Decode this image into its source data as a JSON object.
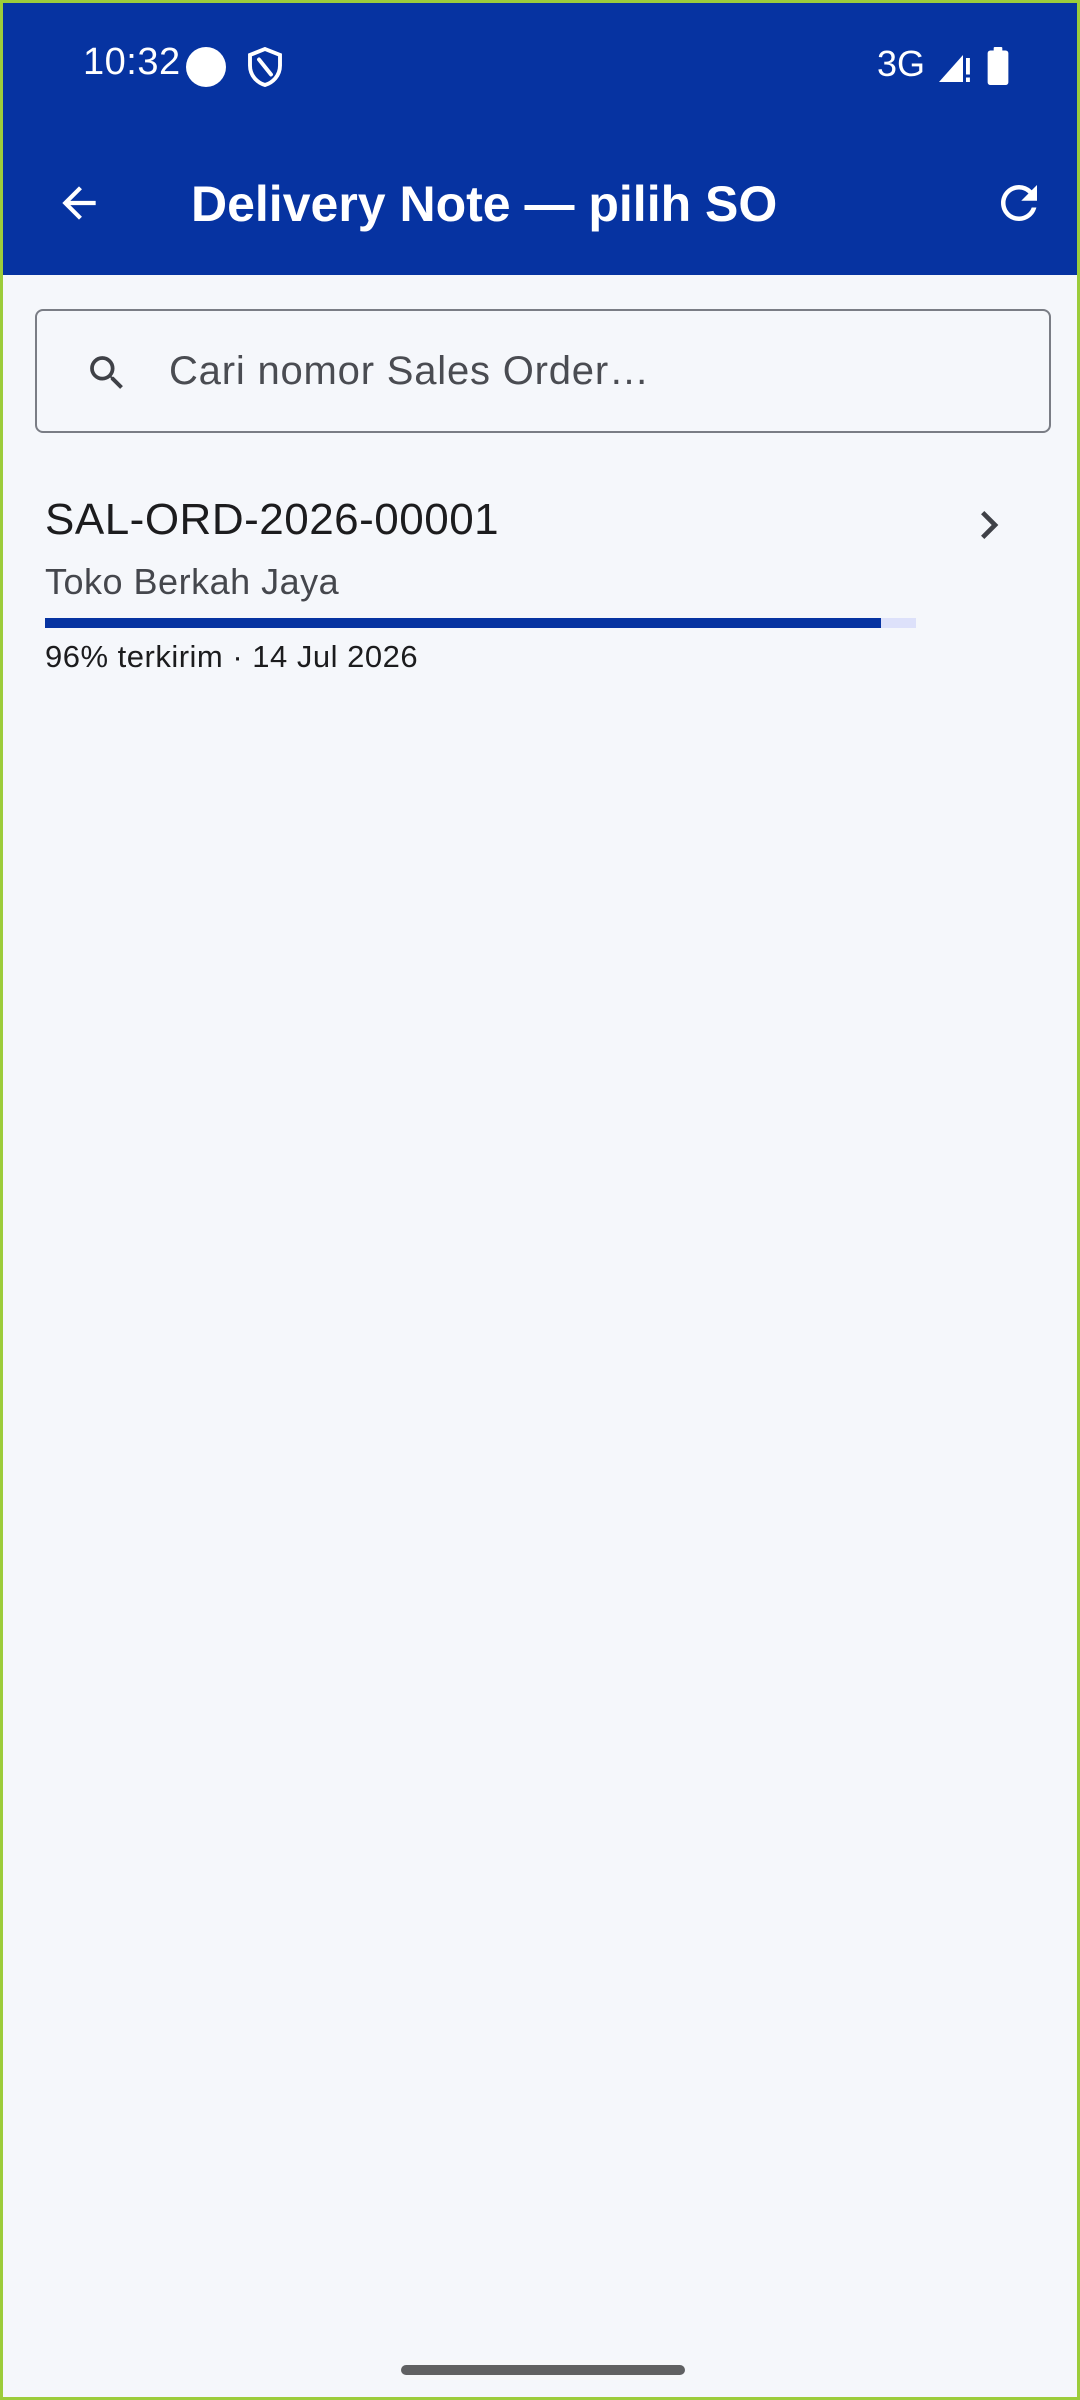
{
  "status_bar": {
    "time": "10:32",
    "network": "3G",
    "icons": [
      "circle-icon",
      "shield-icon",
      "signal-icon",
      "battery-icon"
    ]
  },
  "appbar": {
    "title": "Delivery Note — pilih SO",
    "back_icon": "arrow-back-icon",
    "refresh_icon": "refresh-icon"
  },
  "search": {
    "placeholder": "Cari nomor Sales Order…",
    "value": ""
  },
  "sales_orders": [
    {
      "number": "SAL-ORD-2026-00001",
      "customer": "Toko Berkah Jaya",
      "progress_percent": 96,
      "meta": "96% terkirim · 14 Jul 2026"
    }
  ],
  "colors": {
    "primary": "#0633a1",
    "background": "#f5f7fb",
    "progress_track": "#dde1fa"
  }
}
